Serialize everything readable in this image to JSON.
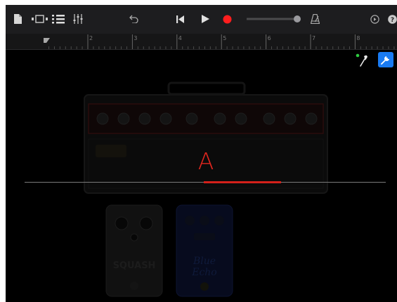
{
  "ruler": {
    "bars": [
      "2",
      "3",
      "4",
      "5",
      "6",
      "7",
      "8"
    ]
  },
  "tuner": {
    "note": "A",
    "accent_color": "#e0261e",
    "signal_level": 0.72
  },
  "pedals": [
    {
      "name_line1": "SQUASH",
      "name_line2": ""
    },
    {
      "name_line1": "Blue",
      "name_line2": "Echo"
    }
  ],
  "colors": {
    "record": "#ff1e1e",
    "settings_active": "#1a7bf2",
    "input_led": "#2ecc40"
  },
  "icons": [
    "document-icon",
    "tracks-view-icon",
    "browser-list-icon",
    "mixer-icon",
    "undo-icon",
    "go-to-start-icon",
    "play-icon",
    "record-icon",
    "master-volume-slider",
    "metronome-icon",
    "tempo-icon",
    "help-icon",
    "input-icon",
    "settings-icon"
  ]
}
